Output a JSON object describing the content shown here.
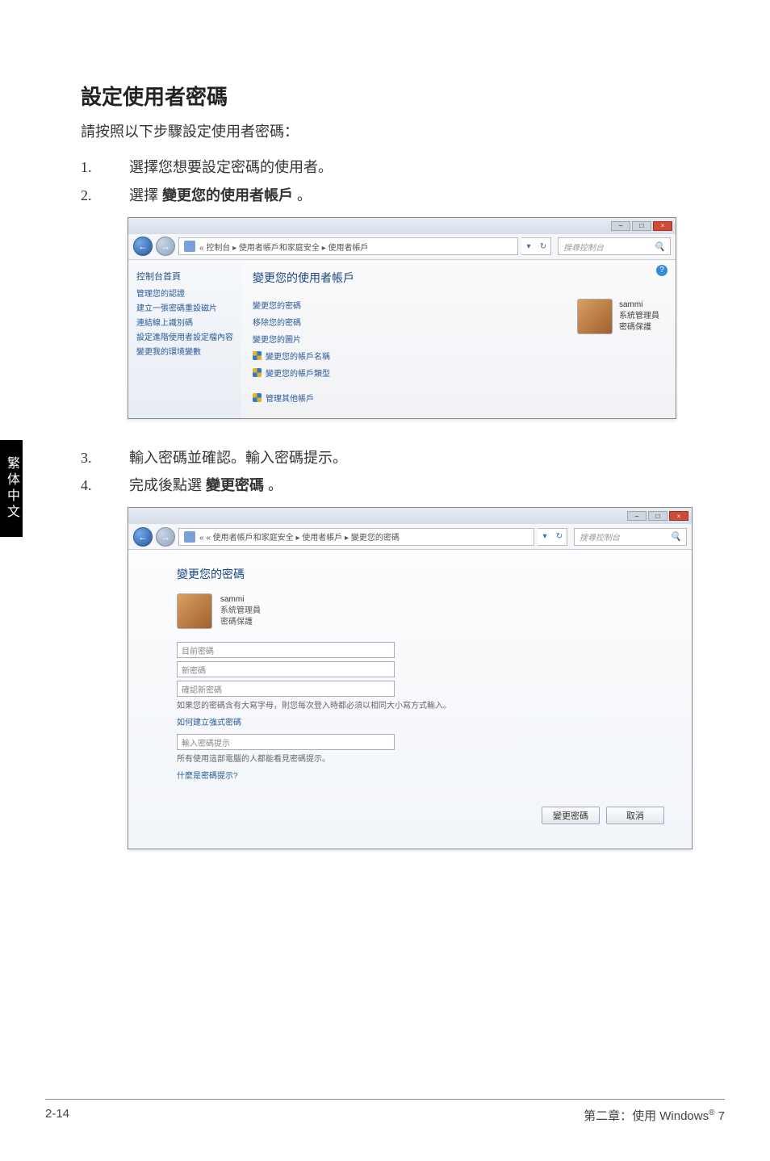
{
  "heading": "設定使用者密碼",
  "intro": "請按照以下步驟設定使用者密碼：",
  "steps": {
    "s1_num": "1.",
    "s1_text": "選擇您想要設定密碼的使用者。",
    "s2_num": "2.",
    "s2_text_a": "選擇 ",
    "s2_text_b": "變更您的使用者帳戶",
    "s2_text_c": " 。",
    "s3_num": "3.",
    "s3_text": "輸入密碼並確認。輸入密碼提示。",
    "s4_num": "4.",
    "s4_text_a": "完成後點選 ",
    "s4_text_b": "變更密碼",
    "s4_text_c": " 。"
  },
  "side_tab": "繁体中文",
  "win1": {
    "crumb": "« 控制台 ▸ 使用者帳戶和家庭安全 ▸ 使用者帳戶",
    "search_placeholder": "搜尋控制台",
    "sidebar_title": "控制台首頁",
    "sidebar_items": [
      "管理您的認證",
      "建立一張密碼重設磁片",
      "連結線上識別碼",
      "設定進階使用者設定檔內容",
      "變更我的環境變數"
    ],
    "main_title": "變更您的使用者帳戶",
    "links": [
      "變更您的密碼",
      "移除您的密碼",
      "變更您的圖片",
      "變更您的帳戶名稱",
      "變更您的帳戶類型"
    ],
    "links2": [
      "管理其他帳戶"
    ],
    "user_name": "sammi",
    "user_role": "系統管理員",
    "user_prot": "密碼保護"
  },
  "win2": {
    "crumb": "« « 使用者帳戶和家庭安全 ▸ 使用者帳戶 ▸ 變更您的密碼",
    "search_placeholder": "搜尋控制台",
    "title": "變更您的密碼",
    "user_name": "sammi",
    "user_role": "系統管理員",
    "user_prot": "密碼保護",
    "ph1": "目前密碼",
    "ph2": "新密碼",
    "ph3": "確認新密碼",
    "note1": "如果您的密碼含有大寫字母，則您每次登入時都必須以相同大小寫方式輸入。",
    "note1_link": "如何建立強式密碼",
    "ph4": "輸入密碼提示",
    "note2": "所有使用這部電腦的人都能看見密碼提示。",
    "note2_link": "什麼是密碼提示?",
    "btn_change": "變更密碼",
    "btn_cancel": "取消"
  },
  "footer": {
    "page": "2-14",
    "chapter_a": "第二章：使用 Windows",
    "chapter_sup": "®",
    "chapter_b": " 7"
  }
}
